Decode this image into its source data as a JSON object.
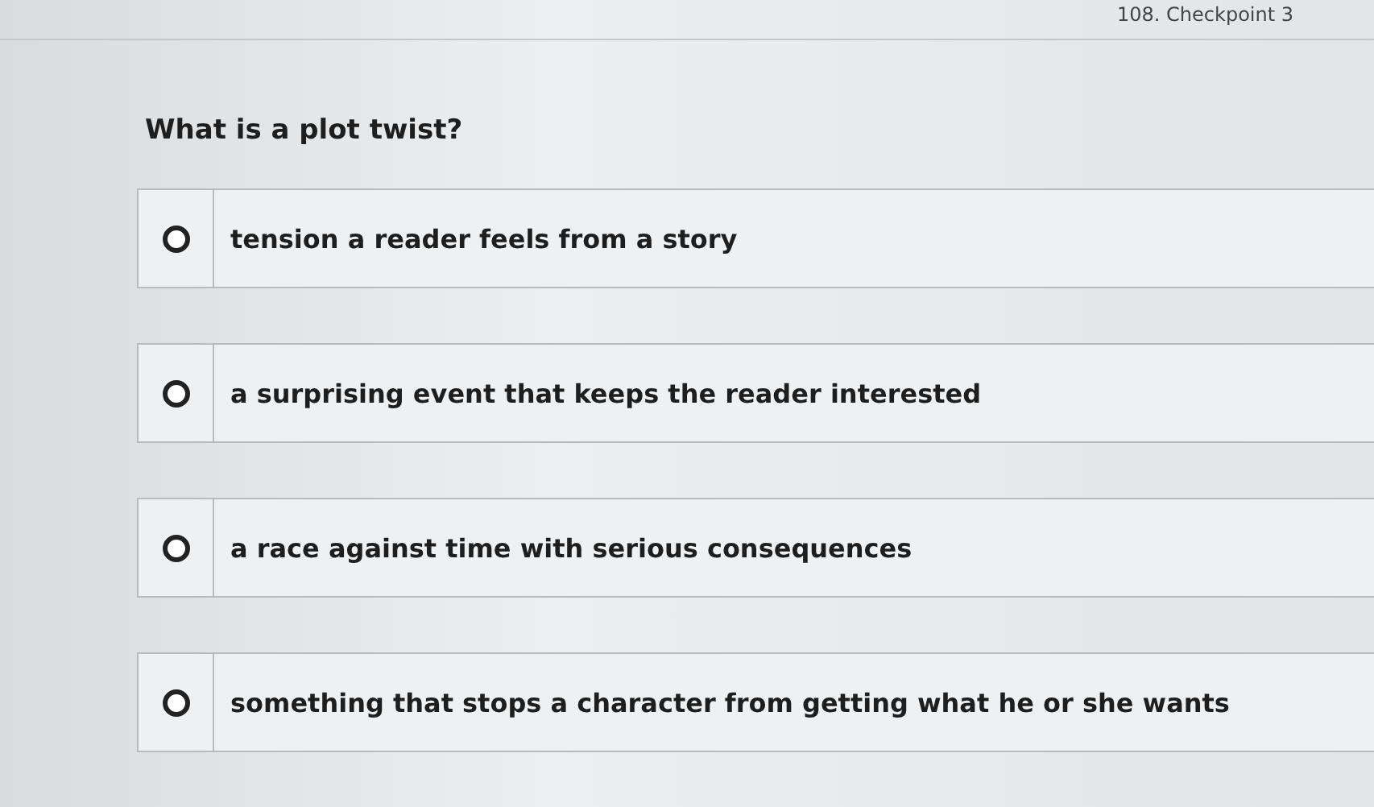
{
  "header": {
    "title": "108. Checkpoint 3"
  },
  "question": "What is a plot twist?",
  "options": [
    {
      "label": "tension a reader feels from a story",
      "selected": false
    },
    {
      "label": "a surprising event that keeps the reader interested",
      "selected": false
    },
    {
      "label": "a race against time with serious consequences",
      "selected": false
    },
    {
      "label": "something that stops a character from getting what he or she wants",
      "selected": false
    }
  ]
}
